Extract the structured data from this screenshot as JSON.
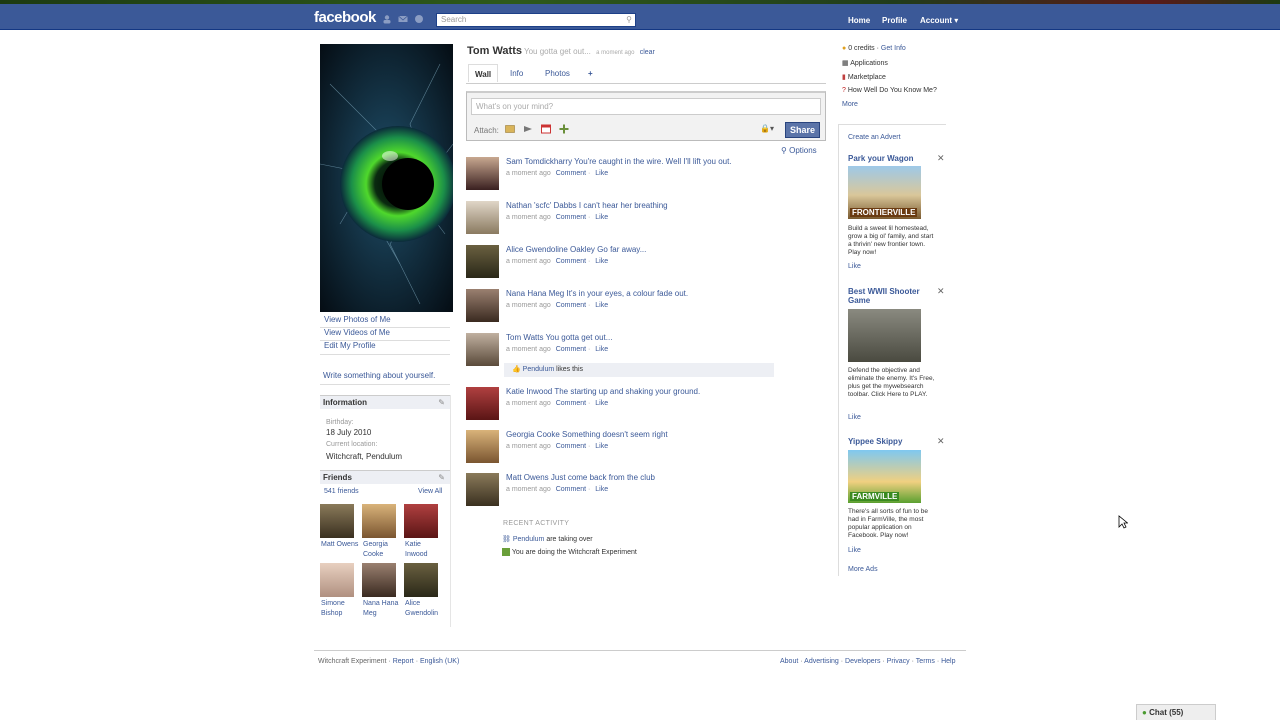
{
  "header": {
    "logo": "facebook",
    "search_placeholder": "Search",
    "nav": [
      "Home",
      "Profile",
      "Account ▾"
    ]
  },
  "profile": {
    "name": "Tom Watts",
    "status": "You gotta get out...",
    "status_time": "a moment ago",
    "status_clear": "clear",
    "left_links": [
      "View Photos of Me",
      "View Videos of Me",
      "Edit My Profile"
    ],
    "write_about": "Write something about yourself.",
    "info": {
      "title": "Information",
      "birthday_label": "Birthday:",
      "birthday": "18 July 2010",
      "location_label": "Current location:",
      "location": "Witchcraft, Pendulum"
    },
    "friends": {
      "title": "Friends",
      "count": "541 friends",
      "see_all": "View All",
      "list": [
        {
          "name": "Matt Owens"
        },
        {
          "name": "Georgia Cooke"
        },
        {
          "name": "Katie Inwood"
        },
        {
          "name": "Simone Bishop"
        },
        {
          "name": "Nana Hana Meg"
        },
        {
          "name": "Alice Gwendolin"
        }
      ]
    }
  },
  "tabs": [
    "Wall",
    "Info",
    "Photos",
    "+"
  ],
  "composer": {
    "placeholder": "What's on your mind?",
    "attach_label": "Attach:",
    "share_label": "Share",
    "lock": "🔒▾"
  },
  "options_label": "Options",
  "stories": [
    {
      "author": "Sam Tomdickharry",
      "text": "You're caught in the wire. Well I'll lift you out.",
      "time": "a moment ago",
      "comment": "Comment",
      "like": "Like"
    },
    {
      "author": "Nathan 'scfc' Dabbs",
      "text": "I can't hear her breathing",
      "time": "a moment ago",
      "comment": "Comment",
      "like": "Like"
    },
    {
      "author": "Alice Gwendoline Oakley",
      "text": "Go far away...",
      "time": "a moment ago",
      "comment": "Comment",
      "like": "Like"
    },
    {
      "author": "Nana Hana Meg",
      "text": "It's in your eyes, a colour fade out.",
      "time": "a moment ago",
      "comment": "Comment",
      "like": "Like"
    },
    {
      "author": "Tom Watts",
      "text": "You gotta get out...",
      "time": "a moment ago",
      "comment": "Comment",
      "like": "Like"
    },
    {
      "author": "Katie Inwood",
      "text": "The starting up and shaking your ground.",
      "time": "a moment ago",
      "comment": "Comment",
      "like": "Like"
    },
    {
      "author": "Georgia Cooke",
      "text": "Something doesn't seem right",
      "time": "a moment ago",
      "comment": "Comment",
      "like": "Like"
    },
    {
      "author": "Matt Owens",
      "text": "Just come back from the club",
      "time": "a moment ago",
      "comment": "Comment",
      "like": "Like"
    }
  ],
  "like_row": {
    "who": "Pendulum",
    "text": "likes this"
  },
  "recent_activity": {
    "title": "RECENT ACTIVITY",
    "rows": [
      {
        "who": "Pendulum",
        "text": "are taking over"
      },
      {
        "who": "",
        "text": "You are doing the Witchcraft Experiment"
      }
    ]
  },
  "right": {
    "credits": "0 credits",
    "get_info": "Get Info",
    "apps": [
      "Applications",
      "Marketplace",
      "How Well Do You Know Me?"
    ],
    "more": "More",
    "create_ad": "Create an Advert",
    "ads": [
      {
        "title": "Park your Wagon",
        "text": "Build a sweet lil homestead, grow a big ol' family, and start a thrivin' new frontier town. Play now!",
        "brand": "FRONTIERVILLE",
        "like": "Like"
      },
      {
        "title": "Best WWII Shooter Game",
        "text": "Defend the objective and eliminate the enemy. It's Free, plus get the mywebsearch toolbar. Click Here to PLAY.",
        "like": "Like"
      },
      {
        "title": "Yippee Skippy",
        "text": "There's all sorts of fun to be had in FarmVille, the most popular application on Facebook. Play now!",
        "brand": "FARMVILLE",
        "like": "Like"
      }
    ],
    "more_ads": "More Ads"
  },
  "footer": {
    "left": [
      "Witchcraft Experiment",
      "·",
      "Report",
      "·",
      "English (UK)"
    ],
    "right": [
      "About",
      "·",
      "Advertising",
      "·",
      "Developers",
      "·",
      "Privacy",
      "·",
      "Terms",
      "·",
      "Help"
    ]
  },
  "chat": "Chat (55)"
}
